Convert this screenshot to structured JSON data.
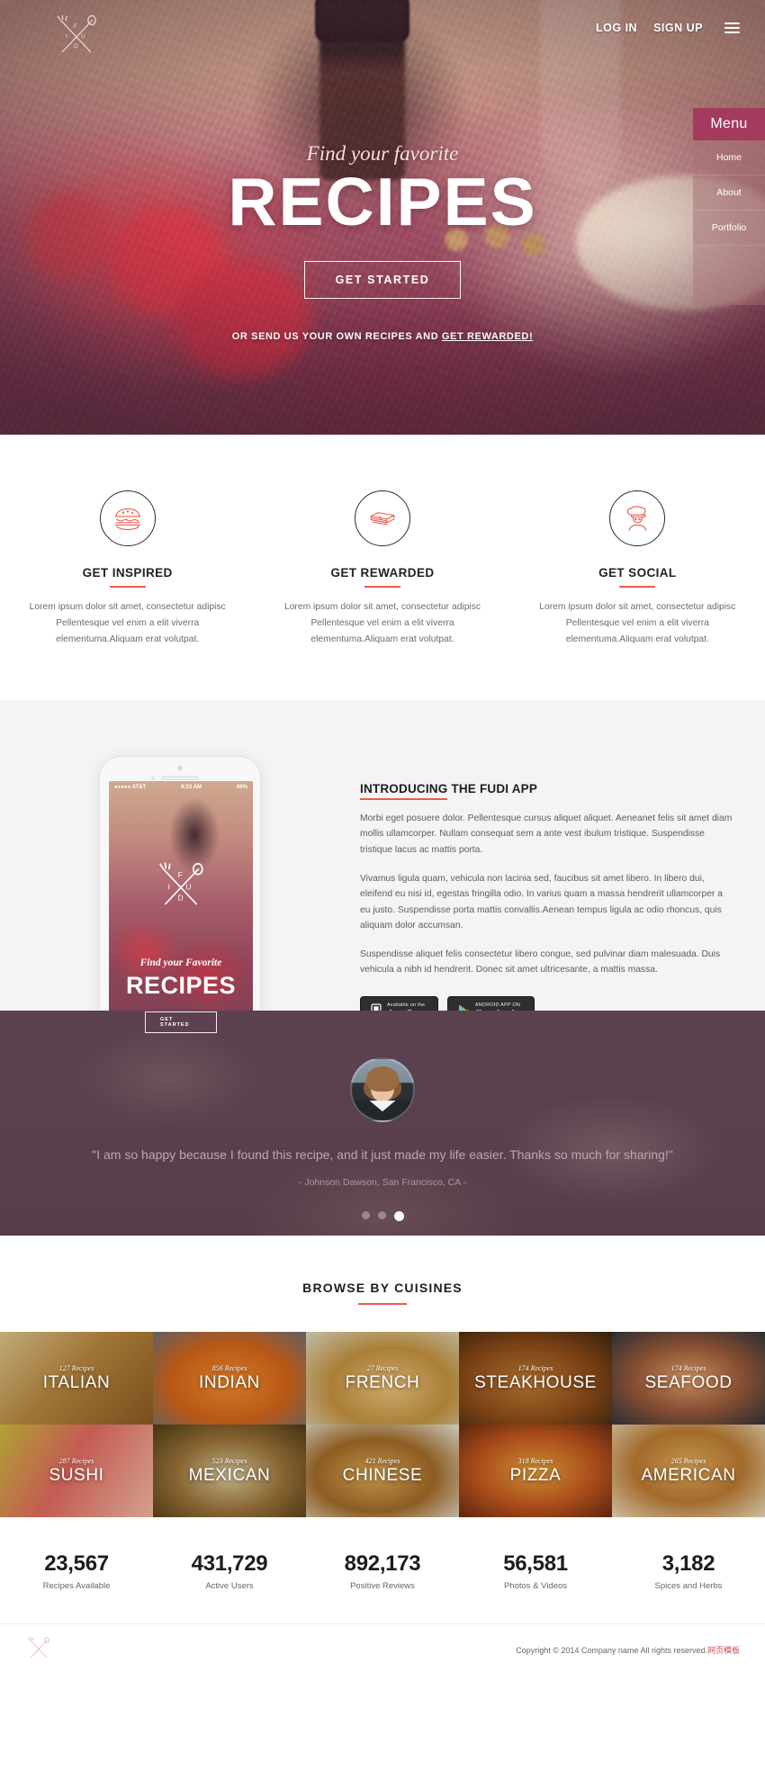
{
  "header": {
    "logo_letters": [
      "F",
      "U",
      "D",
      "I"
    ],
    "login_label": "LOG IN",
    "signup_label": "SIGN UP"
  },
  "slide_menu": {
    "title": "Menu",
    "items": [
      {
        "label": "Home"
      },
      {
        "label": "About"
      },
      {
        "label": "Portfolio"
      }
    ]
  },
  "hero": {
    "eyebrow": "Find your favorite",
    "title": "RECIPES",
    "cta_label": "GET STARTED",
    "sub_prefix": "OR SEND US YOUR OWN RECIPES AND ",
    "sub_link": "GET REWARDED!"
  },
  "features": [
    {
      "icon": "burger-icon",
      "title": "GET INSPIRED",
      "desc": "Lorem ipsum dolor sit amet, consectetur adipisc Pellentesque vel enim a elit viverra elementuma.Aliquam erat volutpat."
    },
    {
      "icon": "money-icon",
      "title": "GET REWARDED",
      "desc": "Lorem ipsum dolor sit amet, consectetur adipisc Pellentesque vel enim a elit viverra elementuma.Aliquam erat volutpat."
    },
    {
      "icon": "chef-icon",
      "title": "GET SOCIAL",
      "desc": "Lorem ipsum dolor sit amet, consectetur adipisc Pellentesque vel enim a elit viverra elementuma.Aliquam erat volutpat."
    }
  ],
  "app": {
    "title_underlined": "INTRODUCING",
    "title_rest": " THE FUDI APP",
    "paragraph1": "Morbi eget posuere dolor. Pellentesque cursus aliquet aliquet. Aeneanet felis sit amet diam mollis ullamcorper. Nullam consequat sem a ante vest ibulum tristique. Suspendisse tristique lacus ac mattis porta.",
    "paragraph2": "Vivamus ligula quam, vehicula non lacinia sed, faucibus sit amet libero. In libero dui, eleifend eu nisi id, egestas fringilla odio. In varius quam a massa hendrerit ullamcorper a eu justo. Suspendisse porta mattis convallis.Aenean tempus ligula ac odio rhoncus, quis aliquam dolor accumsan.",
    "paragraph3": "Suspendisse aliquet felis consectetur libero congue, sed pulvinar diam malesuada. Duis vehicula a nibh id hendrerit. Donec sit amet ultricesante, a mattis massa.",
    "appstore_top": "Available on the",
    "appstore_bottom": "App Store",
    "googleplay_top": "ANDROID APP ON",
    "googleplay_bottom": "Google play",
    "phone": {
      "carrier": "●●●●● AT&T",
      "time": "9:23 AM",
      "battery": "66%",
      "eyebrow": "Find your Favorite",
      "title": "RECIPES",
      "cta": "GET STARTED"
    }
  },
  "testimonial": {
    "quote": "\"I am so happy because I found this recipe, and it just made my life easier. Thanks so much for sharing!\"",
    "author": "- Johnson Dawson, San Francisco, CA -",
    "slides": [
      {
        "active": false
      },
      {
        "active": false
      },
      {
        "active": true
      }
    ]
  },
  "cuisines": {
    "heading": "BROWSE BY CUISINES",
    "items": [
      {
        "name": "ITALIAN",
        "recipes": "127 Recipes"
      },
      {
        "name": "INDIAN",
        "recipes": "856 Recipes"
      },
      {
        "name": "FRENCH",
        "recipes": "27 Recipes"
      },
      {
        "name": "STEAKHOUSE",
        "recipes": "174 Recipes"
      },
      {
        "name": "SEAFOOD",
        "recipes": "174 Recipes"
      },
      {
        "name": "SUSHI",
        "recipes": "287 Recipes"
      },
      {
        "name": "MEXICAN",
        "recipes": "523 Recipes"
      },
      {
        "name": "CHINESE",
        "recipes": "421 Recipes"
      },
      {
        "name": "PIZZA",
        "recipes": "318 Recipes"
      },
      {
        "name": "AMERICAN",
        "recipes": "265 Recipes"
      }
    ]
  },
  "stats": [
    {
      "number": "23,567",
      "label": "Recipes Available"
    },
    {
      "number": "431,729",
      "label": "Active Users"
    },
    {
      "number": "892,173",
      "label": "Positive Reviews"
    },
    {
      "number": "56,581",
      "label": "Photos & Videos"
    },
    {
      "number": "3,182",
      "label": "Spices and Herbs"
    }
  ],
  "footer": {
    "copyright": "Copyright © 2014 Company name All rights reserved.",
    "cn_text": "网页模板"
  },
  "colors": {
    "accent": "#ef5a4c",
    "menu_header": "#a33b5e",
    "testimonial_bg": "#5a3f4d"
  }
}
